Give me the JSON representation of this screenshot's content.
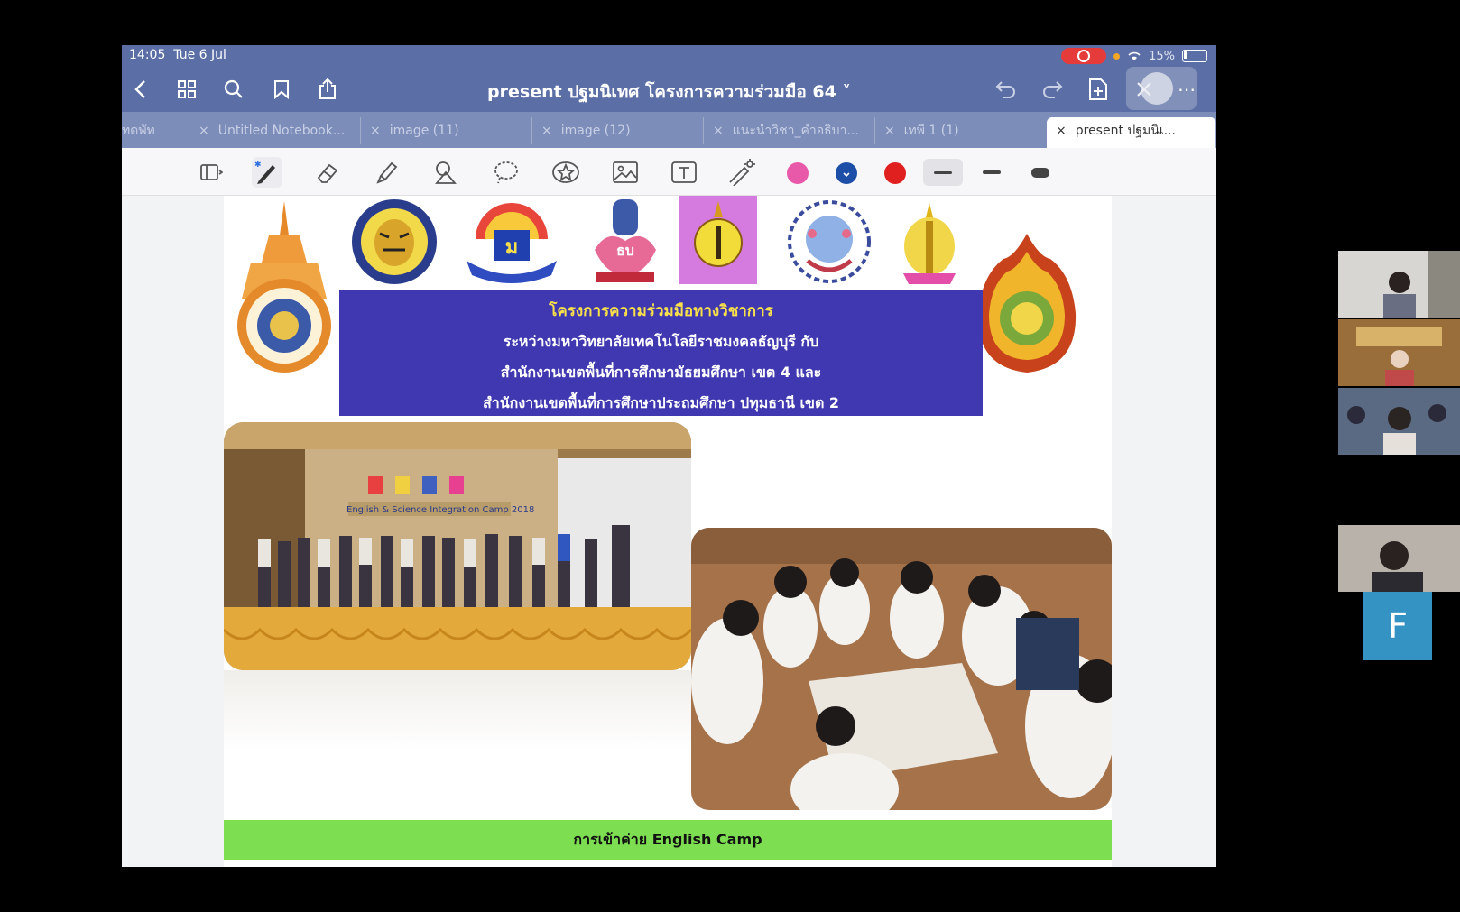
{
  "status": {
    "time": "14:05",
    "date": "Tue 6 Jul",
    "battery": "15%"
  },
  "nav": {
    "title": "present ปฐมนิเทศ โครงการความร่วมมือ 64 ˅"
  },
  "tabs": [
    {
      "label": "ทดพัท"
    },
    {
      "label": "Untitled Notebook..."
    },
    {
      "label": "image (11)"
    },
    {
      "label": "image (12)"
    },
    {
      "label": "แนะนำวิชา_คำอธิบา..."
    },
    {
      "label": "เทพี 1 (1)"
    },
    {
      "label": "present ปฐมนิเ..."
    }
  ],
  "toolbar": {
    "tools": [
      "pages-icon",
      "pen-icon",
      "eraser-icon",
      "highlighter-icon",
      "shapes-icon",
      "lasso-icon",
      "sticker-icon",
      "image-icon",
      "text-icon",
      "laser-icon"
    ],
    "colors": [
      "#e85aa9",
      "#1d4fa8",
      "#e0201e"
    ]
  },
  "page": {
    "banner": {
      "line1": "โครงการความร่วมมือทางวิชาการ",
      "line2": "ระหว่างมหาวิทยาลัยเทคโนโลยีราชมงคลธัญบุรี กับ",
      "line3": "สำนักงานเขตพื้นที่การศึกษามัธยมศึกษา เขต 4 และ",
      "line4": "สำนักงานเขตพื้นที่การศึกษาประถมศึกษา ปทุมธานี เขต 2"
    },
    "photo1_sign": "English & Science Integration Camp 2018",
    "caption": "การเข้าค่าย English Camp"
  },
  "participants": {
    "avatar_letter": "F"
  }
}
